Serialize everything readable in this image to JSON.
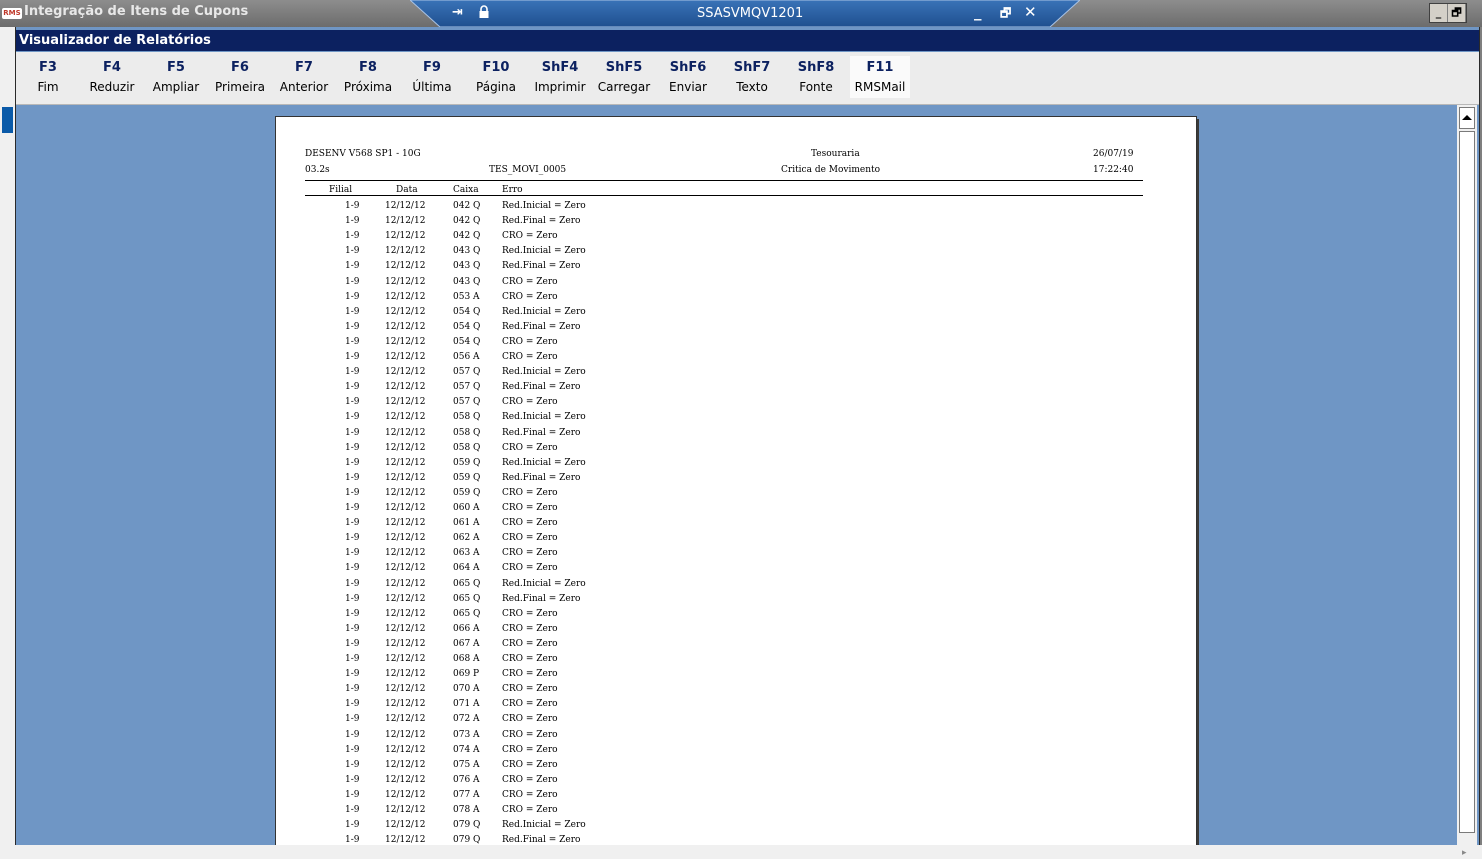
{
  "window": {
    "title": "Integração de Itens de Cupons",
    "logo_text": "RMS",
    "rdp_host": "SSASVMQV1201",
    "rdp_min": "_",
    "rdp_restore": "🗗",
    "rdp_close": "✕",
    "pin_glyph": "⇥",
    "win_min": "_",
    "win_restore": "🗗"
  },
  "header": {
    "title": "Visualizador de Relatórios"
  },
  "toolbar": {
    "keys": [
      {
        "key": "F3",
        "label": "Fim"
      },
      {
        "key": "F4",
        "label": "Reduzir"
      },
      {
        "key": "F5",
        "label": "Ampliar"
      },
      {
        "key": "F6",
        "label": "Primeira"
      },
      {
        "key": "F7",
        "label": "Anterior"
      },
      {
        "key": "F8",
        "label": "Próxima"
      },
      {
        "key": "F9",
        "label": "Última"
      },
      {
        "key": "F10",
        "label": "Página"
      },
      {
        "key": "ShF4",
        "label": "Imprimir"
      },
      {
        "key": "ShF5",
        "label": "Carregar"
      },
      {
        "key": "ShF6",
        "label": "Enviar"
      },
      {
        "key": "ShF7",
        "label": "Texto"
      },
      {
        "key": "ShF8",
        "label": "Fonte"
      },
      {
        "key": "F11",
        "label": "RMSMail"
      }
    ]
  },
  "report": {
    "system": "DESENV V568 SP1 - 10G",
    "version": "03.2s",
    "report_id": "TES_MOVI_0005",
    "department": "Tesouraria",
    "title": "Critica de Movimento",
    "date": "26/07/19",
    "time": "17:22:40",
    "columns": [
      "Filial",
      "Data",
      "Caixa",
      "Erro"
    ],
    "rows": [
      [
        "1-9",
        "12/12/12",
        "042 Q",
        "Red.Inicial = Zero"
      ],
      [
        "1-9",
        "12/12/12",
        "042 Q",
        "Red.Final = Zero"
      ],
      [
        "1-9",
        "12/12/12",
        "042 Q",
        "CRO = Zero"
      ],
      [
        "1-9",
        "12/12/12",
        "043 Q",
        "Red.Inicial = Zero"
      ],
      [
        "1-9",
        "12/12/12",
        "043 Q",
        "Red.Final = Zero"
      ],
      [
        "1-9",
        "12/12/12",
        "043 Q",
        "CRO = Zero"
      ],
      [
        "1-9",
        "12/12/12",
        "053 A",
        "CRO = Zero"
      ],
      [
        "1-9",
        "12/12/12",
        "054 Q",
        "Red.Inicial = Zero"
      ],
      [
        "1-9",
        "12/12/12",
        "054 Q",
        "Red.Final = Zero"
      ],
      [
        "1-9",
        "12/12/12",
        "054 Q",
        "CRO = Zero"
      ],
      [
        "1-9",
        "12/12/12",
        "056 A",
        "CRO = Zero"
      ],
      [
        "1-9",
        "12/12/12",
        "057 Q",
        "Red.Inicial = Zero"
      ],
      [
        "1-9",
        "12/12/12",
        "057 Q",
        "Red.Final = Zero"
      ],
      [
        "1-9",
        "12/12/12",
        "057 Q",
        "CRO = Zero"
      ],
      [
        "1-9",
        "12/12/12",
        "058 Q",
        "Red.Inicial = Zero"
      ],
      [
        "1-9",
        "12/12/12",
        "058 Q",
        "Red.Final = Zero"
      ],
      [
        "1-9",
        "12/12/12",
        "058 Q",
        "CRO = Zero"
      ],
      [
        "1-9",
        "12/12/12",
        "059 Q",
        "Red.Inicial = Zero"
      ],
      [
        "1-9",
        "12/12/12",
        "059 Q",
        "Red.Final = Zero"
      ],
      [
        "1-9",
        "12/12/12",
        "059 Q",
        "CRO = Zero"
      ],
      [
        "1-9",
        "12/12/12",
        "060 A",
        "CRO = Zero"
      ],
      [
        "1-9",
        "12/12/12",
        "061 A",
        "CRO = Zero"
      ],
      [
        "1-9",
        "12/12/12",
        "062 A",
        "CRO = Zero"
      ],
      [
        "1-9",
        "12/12/12",
        "063 A",
        "CRO = Zero"
      ],
      [
        "1-9",
        "12/12/12",
        "064 A",
        "CRO = Zero"
      ],
      [
        "1-9",
        "12/12/12",
        "065 Q",
        "Red.Inicial = Zero"
      ],
      [
        "1-9",
        "12/12/12",
        "065 Q",
        "Red.Final = Zero"
      ],
      [
        "1-9",
        "12/12/12",
        "065 Q",
        "CRO = Zero"
      ],
      [
        "1-9",
        "12/12/12",
        "066 A",
        "CRO = Zero"
      ],
      [
        "1-9",
        "12/12/12",
        "067 A",
        "CRO = Zero"
      ],
      [
        "1-9",
        "12/12/12",
        "068 A",
        "CRO = Zero"
      ],
      [
        "1-9",
        "12/12/12",
        "069 P",
        "CRO = Zero"
      ],
      [
        "1-9",
        "12/12/12",
        "070 A",
        "CRO = Zero"
      ],
      [
        "1-9",
        "12/12/12",
        "071 A",
        "CRO = Zero"
      ],
      [
        "1-9",
        "12/12/12",
        "072 A",
        "CRO = Zero"
      ],
      [
        "1-9",
        "12/12/12",
        "073 A",
        "CRO = Zero"
      ],
      [
        "1-9",
        "12/12/12",
        "074 A",
        "CRO = Zero"
      ],
      [
        "1-9",
        "12/12/12",
        "075 A",
        "CRO = Zero"
      ],
      [
        "1-9",
        "12/12/12",
        "076 A",
        "CRO = Zero"
      ],
      [
        "1-9",
        "12/12/12",
        "077 A",
        "CRO = Zero"
      ],
      [
        "1-9",
        "12/12/12",
        "078 A",
        "CRO = Zero"
      ],
      [
        "1-9",
        "12/12/12",
        "079 Q",
        "Red.Inicial = Zero"
      ],
      [
        "1-9",
        "12/12/12",
        "079 Q",
        "Red.Final = Zero"
      ]
    ]
  }
}
